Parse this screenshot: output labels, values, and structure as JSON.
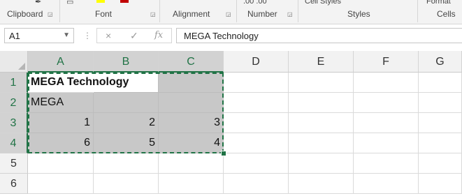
{
  "ribbon": {
    "groups": [
      {
        "id": "clipboard",
        "label": "Clipboard"
      },
      {
        "id": "font",
        "label": "Font"
      },
      {
        "id": "alignment",
        "label": "Alignment"
      },
      {
        "id": "number",
        "label": "Number"
      },
      {
        "id": "styles",
        "label": "Styles"
      },
      {
        "id": "cells",
        "label": "Cells"
      }
    ],
    "fragments": {
      "number_fragment": ".00 .00",
      "cell_styles": "Cell Styles",
      "format": "Format"
    },
    "colors": {
      "highlight": "#ffff00",
      "font_color": "#c00000",
      "accent": "#217346"
    }
  },
  "formula_bar": {
    "name_box": "A1",
    "cancel_icon": "×",
    "enter_icon": "✓",
    "function_icon": "fx",
    "content": "MEGA Technology"
  },
  "sheet": {
    "columns": [
      "A",
      "B",
      "C",
      "D",
      "E",
      "F",
      "G"
    ],
    "rows": [
      "1",
      "2",
      "3",
      "4",
      "5",
      "6"
    ],
    "cells": {
      "A1": "MEGA Technology",
      "A2": "MEGA",
      "A3": "1",
      "B3": "2",
      "C3": "3",
      "A4": "6",
      "B4": "5",
      "C4": "4"
    },
    "selection": "A1:C4",
    "copy_marquee": "A1:C4"
  }
}
